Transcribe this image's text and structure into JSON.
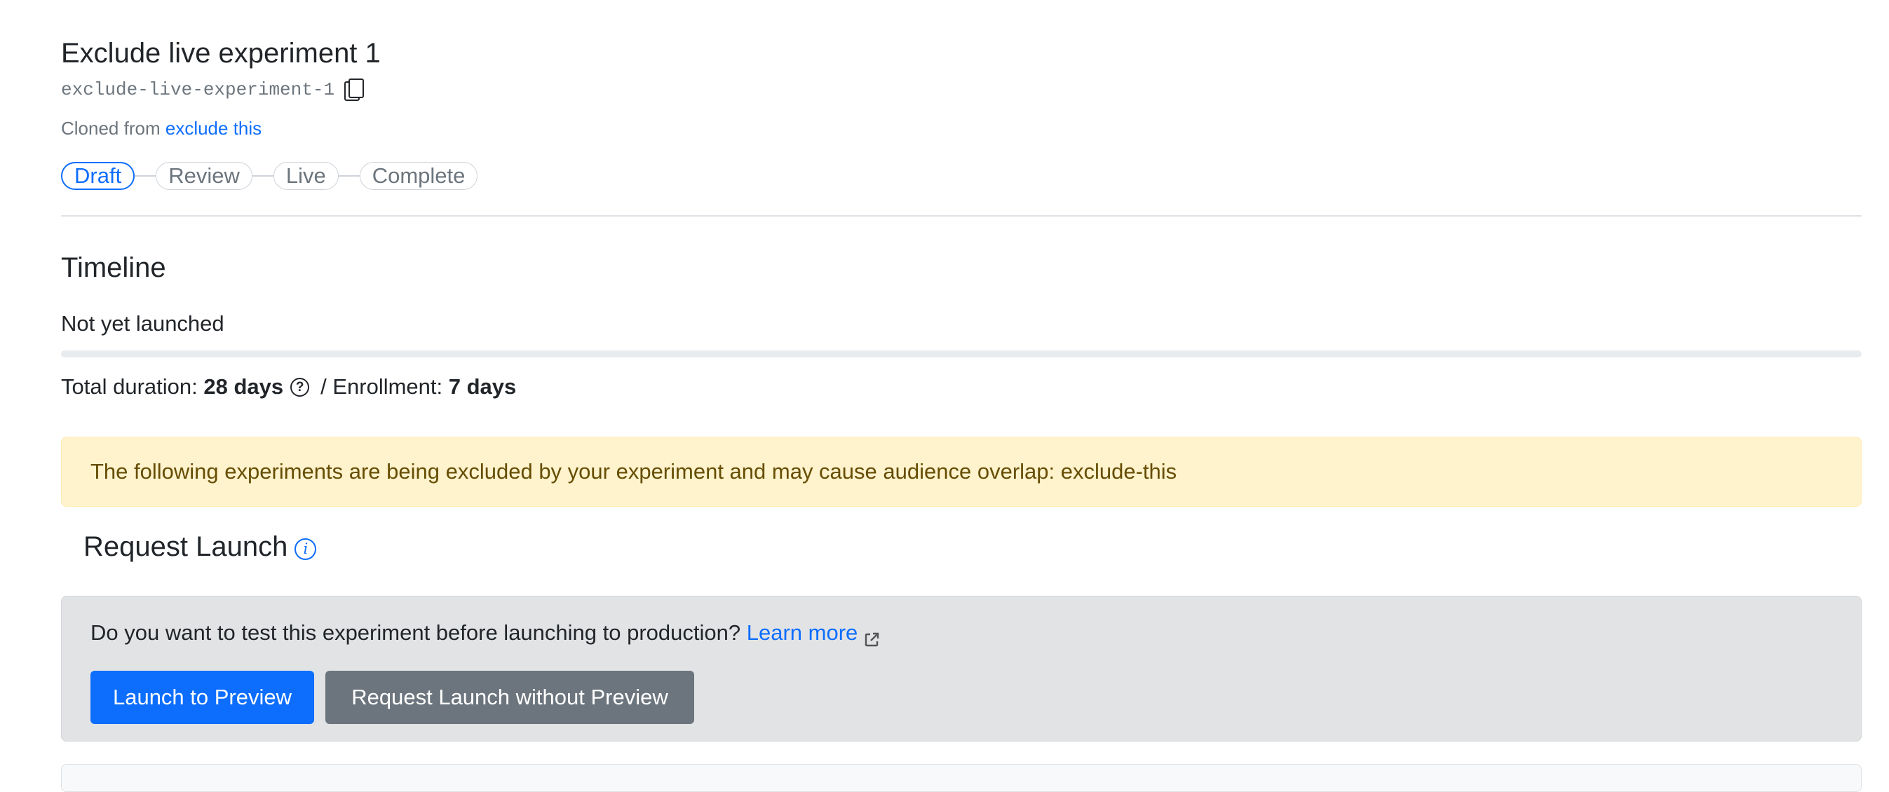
{
  "experiment": {
    "title": "Exclude live experiment 1",
    "slug": "exclude-live-experiment-1",
    "cloned_prefix": "Cloned from",
    "cloned_link": "exclude this"
  },
  "status_steps": [
    "Draft",
    "Review",
    "Live",
    "Complete"
  ],
  "active_step": "Draft",
  "timeline": {
    "heading": "Timeline",
    "state": "Not yet launched",
    "progress": 0,
    "duration_label": "Total duration:",
    "duration_value": "28 days",
    "enrollment_label": "/ Enrollment:",
    "enrollment_value": "7 days"
  },
  "warning": {
    "text": "The following experiments are being excluded by your experiment and may cause audience overlap: exclude-this"
  },
  "request_launch": {
    "heading": "Request Launch",
    "question": "Do you want to test this experiment before launching to production?",
    "learn_more": "Learn more",
    "launch_preview_label": "Launch to Preview",
    "request_without_preview_label": "Request Launch without Preview"
  },
  "icons": {
    "copy": "copy-icon",
    "help": "question-circle-icon",
    "info": "info-circle-icon",
    "external": "external-link-icon"
  },
  "colors": {
    "primary": "#0d6efd",
    "secondary": "#6c757d",
    "warning_bg": "#fff3cd",
    "warning_text": "#664d03",
    "card_bg": "#e2e3e5"
  }
}
